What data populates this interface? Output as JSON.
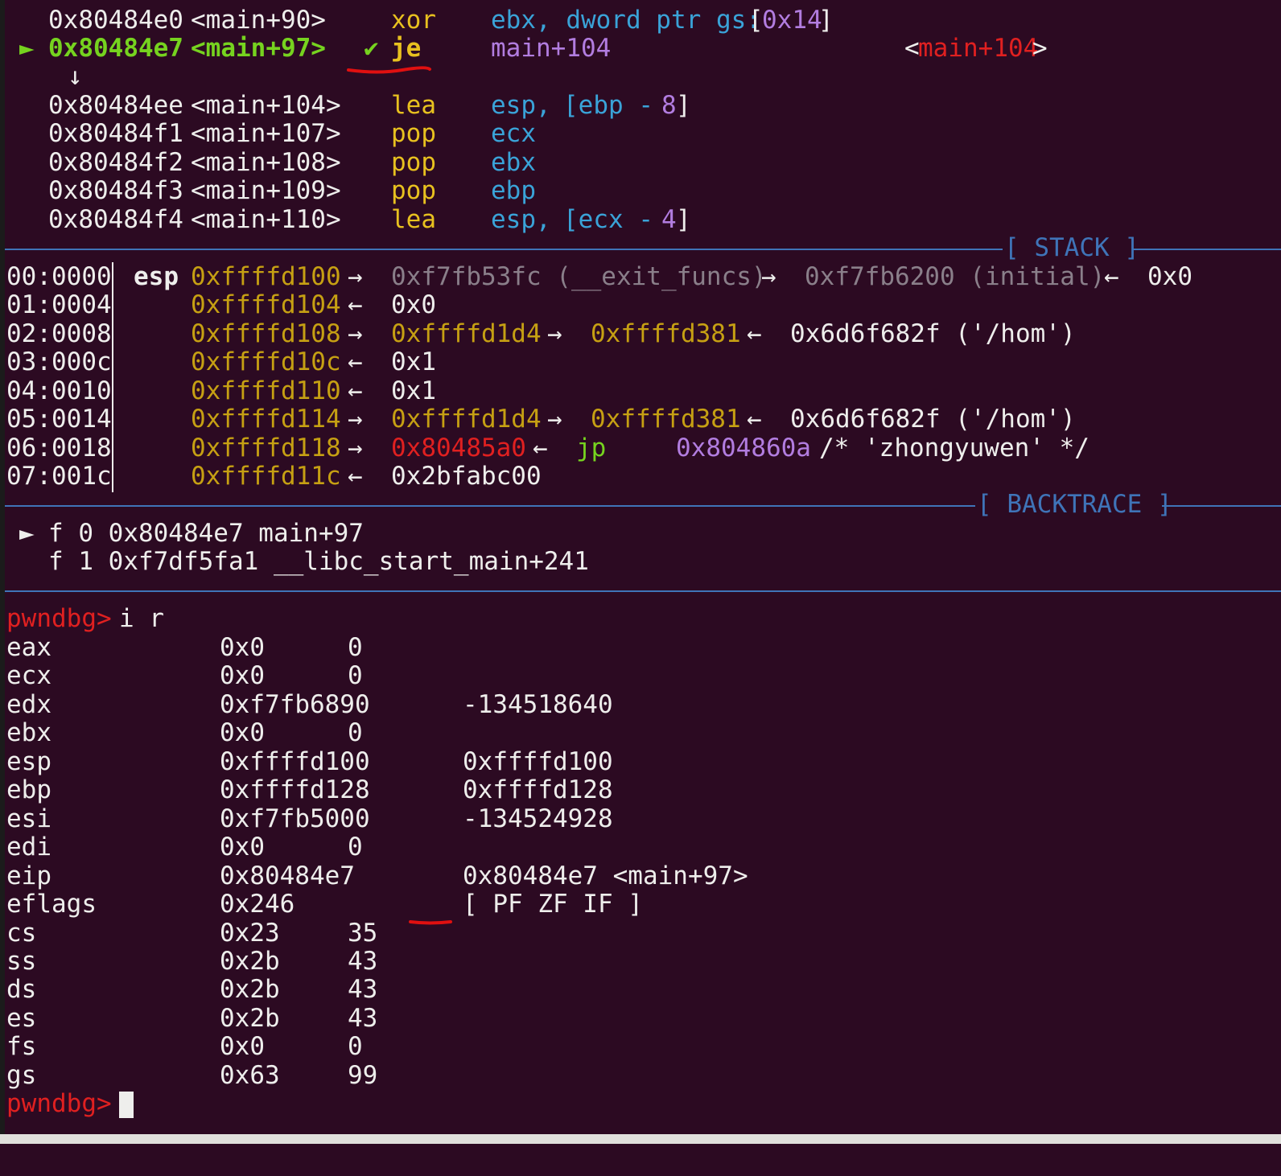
{
  "disasm": {
    "rows": [
      {
        "addr": "0x80484e0",
        "sym": "<main+90>",
        "mnem": "xor",
        "op_a": "ebx, dword ptr gs:",
        "op_b": "[",
        "op_c": "0x14",
        "op_d": "]"
      },
      {
        "marker": "►",
        "addr": "0x80484e7",
        "sym": "<main+97>",
        "check": "✔",
        "mnem": "je",
        "target": "main+104",
        "target_lt": "<",
        "target_sym": "main+104",
        "target_gt": ">"
      },
      {
        "arrow": "↓"
      },
      {
        "addr": "0x80484ee",
        "sym": "<main+104>",
        "mnem": "lea",
        "op_a": "esp, ",
        "op_b": "[ebp - ",
        "op_c": "8",
        "op_d": "]"
      },
      {
        "addr": "0x80484f1",
        "sym": "<main+107>",
        "mnem": "pop",
        "op_a": "ecx"
      },
      {
        "addr": "0x80484f2",
        "sym": "<main+108>",
        "mnem": "pop",
        "op_a": "ebx"
      },
      {
        "addr": "0x80484f3",
        "sym": "<main+109>",
        "mnem": "pop",
        "op_a": "ebp"
      },
      {
        "addr": "0x80484f4",
        "sym": "<main+110>",
        "mnem": "lea",
        "op_a": "esp, ",
        "op_b": "[ecx - ",
        "op_c": "4",
        "op_d": "]"
      }
    ]
  },
  "stack": {
    "header": "[ STACK ]",
    "rows": [
      {
        "idx": "00:0000",
        "reg": "esp",
        "addr": "0xffffd100",
        "a1": "→",
        "v1": "0xf7fb53fc (__exit_funcs)",
        "a2": "→",
        "v2": "0xf7fb6200 (initial)",
        "a3": "←",
        "v3": "0x0"
      },
      {
        "idx": "01:0004",
        "addr": "0xffffd104",
        "a1": "←",
        "v1": "0x0"
      },
      {
        "idx": "02:0008",
        "addr": "0xffffd108",
        "a1": "→",
        "v1": "0xffffd1d4",
        "a2": "→",
        "v2": "0xffffd381",
        "a3": "←",
        "v3": "0x6d6f682f ('/hom')"
      },
      {
        "idx": "03:000c",
        "addr": "0xffffd10c",
        "a1": "←",
        "v1": "0x1"
      },
      {
        "idx": "04:0010",
        "addr": "0xffffd110",
        "a1": "←",
        "v1": "0x1"
      },
      {
        "idx": "05:0014",
        "addr": "0xffffd114",
        "a1": "→",
        "v1": "0xffffd1d4",
        "a2": "→",
        "v2": "0xffffd381",
        "a3": "←",
        "v3": "0x6d6f682f ('/hom')"
      },
      {
        "idx": "06:0018",
        "addr": "0xffffd118",
        "a1": "→",
        "v1": "0x80485a0",
        "a2": "←",
        "v2": "jp",
        "v3": "0x804860a",
        "v4": "/* 'zhongyuwen' */"
      },
      {
        "idx": "07:001c",
        "addr": "0xffffd11c",
        "a1": "←",
        "v1": "0x2bfabc00"
      }
    ]
  },
  "backtrace": {
    "header": "[ BACKTRACE ]",
    "frames": [
      {
        "marker": "►",
        "text": "f 0 0x80484e7 main+97"
      },
      {
        "text": "f 1 0xf7df5fa1 __libc_start_main+241"
      }
    ]
  },
  "prompt": "pwndbg>",
  "command": "i r",
  "registers": [
    {
      "name": "eax",
      "hex": "0x0",
      "val": "0"
    },
    {
      "name": "ecx",
      "hex": "0x0",
      "val": "0"
    },
    {
      "name": "edx",
      "hex": "0xf7fb6890",
      "val": "-134518640"
    },
    {
      "name": "ebx",
      "hex": "0x0",
      "val": "0"
    },
    {
      "name": "esp",
      "hex": "0xffffd100",
      "val": "0xffffd100"
    },
    {
      "name": "ebp",
      "hex": "0xffffd128",
      "val": "0xffffd128"
    },
    {
      "name": "esi",
      "hex": "0xf7fb5000",
      "val": "-134524928"
    },
    {
      "name": "edi",
      "hex": "0x0",
      "val": "0"
    },
    {
      "name": "eip",
      "hex": "0x80484e7",
      "val": "0x80484e7 <main+97>"
    },
    {
      "name": "eflags",
      "hex": "0x246",
      "val": "[ PF ZF IF ]"
    },
    {
      "name": "cs",
      "hex": "0x23",
      "val": "35"
    },
    {
      "name": "ss",
      "hex": "0x2b",
      "val": "43"
    },
    {
      "name": "ds",
      "hex": "0x2b",
      "val": "43"
    },
    {
      "name": "es",
      "hex": "0x2b",
      "val": "43"
    },
    {
      "name": "fs",
      "hex": "0x0",
      "val": "0"
    },
    {
      "name": "gs",
      "hex": "0x63",
      "val": "99"
    }
  ],
  "colors": {
    "prompt": "#e02020",
    "address_gold": "#c6a013",
    "green_current": "#76d31f",
    "separator": "#3f74b8",
    "annotation": "#e01010"
  }
}
